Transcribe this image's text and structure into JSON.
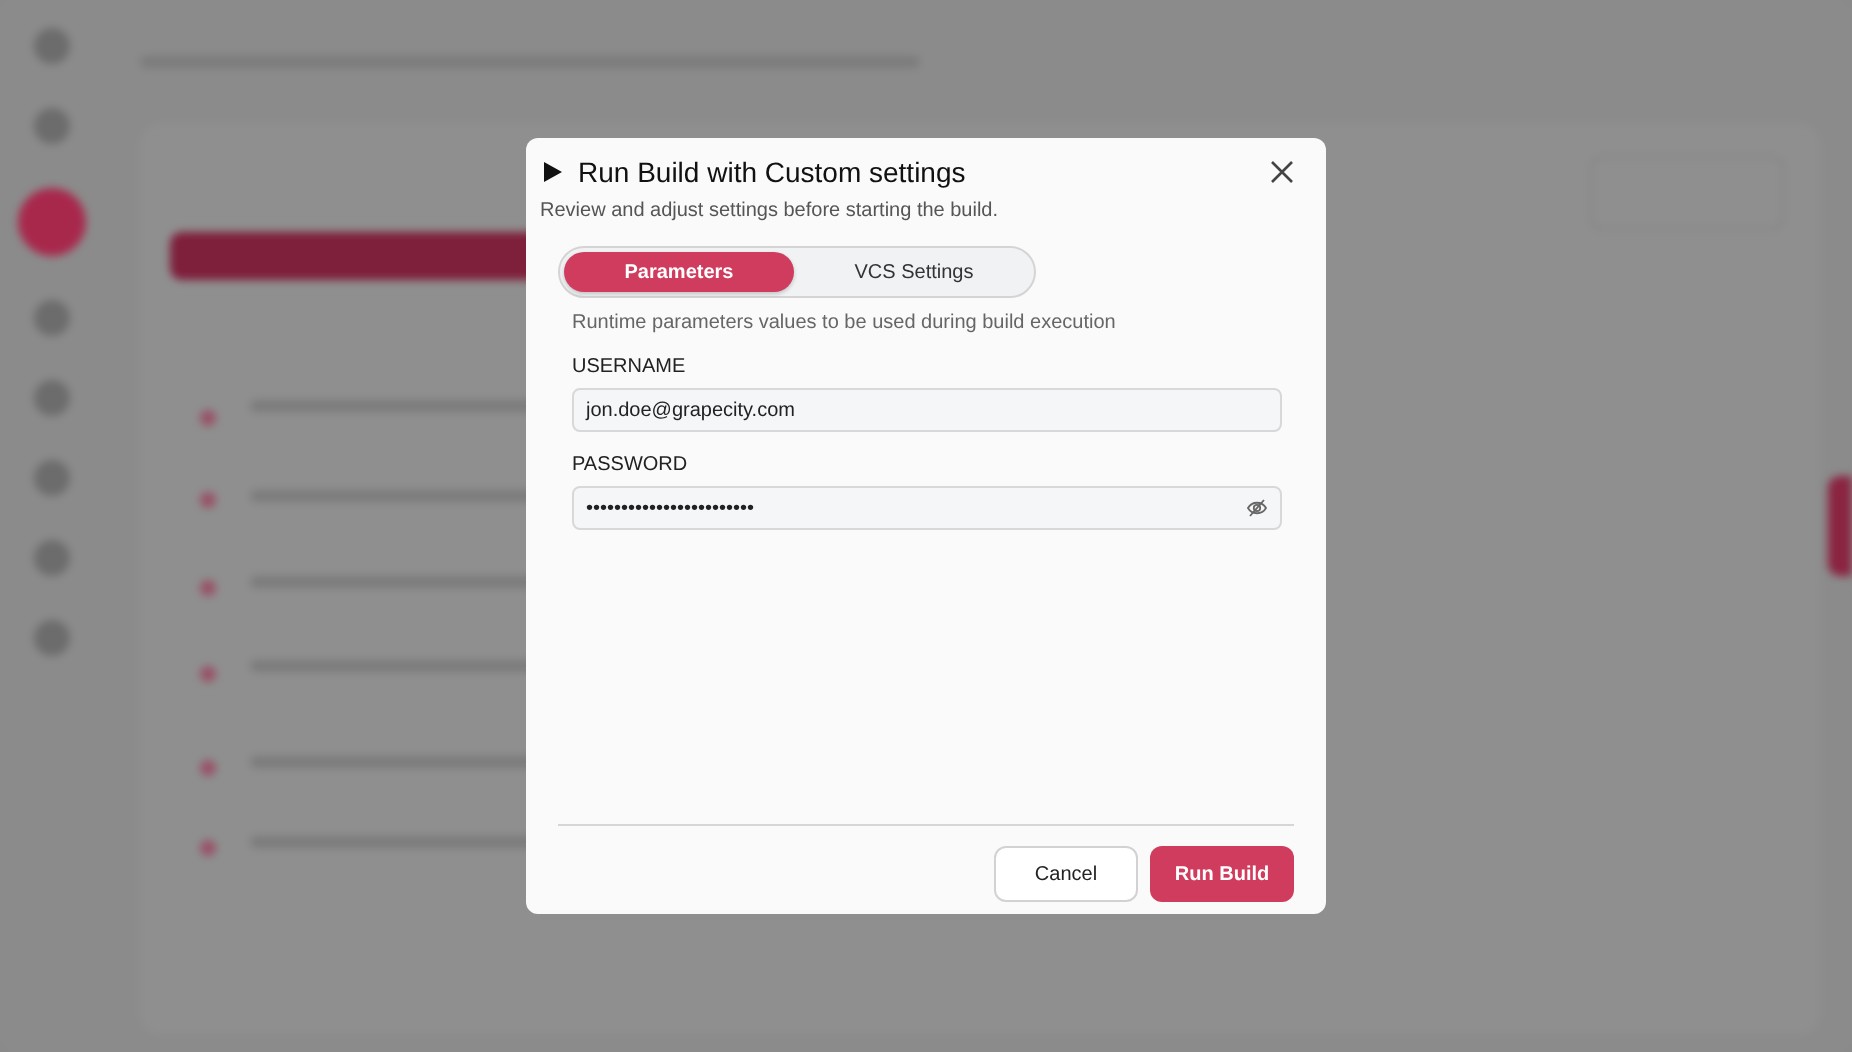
{
  "dialog": {
    "title": "Run Build with Custom settings",
    "subtitle": "Review and adjust settings before starting the build.",
    "tabs": [
      {
        "label": "Parameters",
        "selected": true
      },
      {
        "label": "VCS Settings",
        "selected": false
      }
    ],
    "section_hint": "Runtime parameters values to be used during build execution",
    "fields": [
      {
        "label": "USERNAME",
        "value": "jon.doe@grapecity.com",
        "kind": "text"
      },
      {
        "label": "PASSWORD",
        "value": "••••••••••••••••••••••••",
        "kind": "password"
      }
    ],
    "buttons": [
      {
        "label": "Cancel",
        "kind": "secondary"
      },
      {
        "label": "Run Build",
        "kind": "primary"
      }
    ]
  }
}
